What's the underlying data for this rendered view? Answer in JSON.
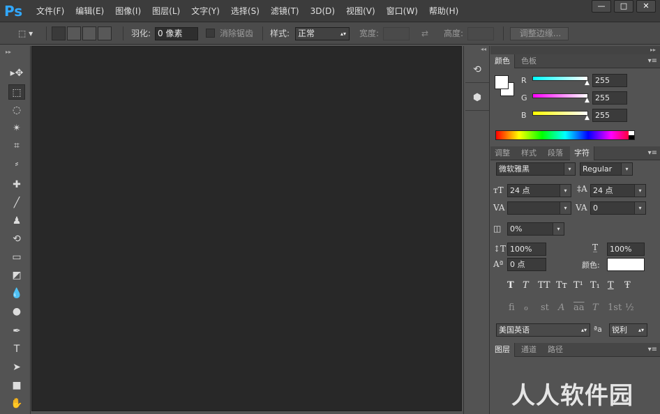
{
  "app": {
    "logo": "Ps"
  },
  "menu": [
    "文件(F)",
    "编辑(E)",
    "图像(I)",
    "图层(L)",
    "文字(Y)",
    "选择(S)",
    "滤镜(T)",
    "3D(D)",
    "视图(V)",
    "窗口(W)",
    "帮助(H)"
  ],
  "window_controls": {
    "minimize": "—",
    "maximize": "□",
    "close": "✕"
  },
  "options": {
    "feather_label": "羽化:",
    "feather_value": "0 像素",
    "antialias_label": "消除锯齿",
    "style_label": "样式:",
    "style_value": "正常",
    "width_label": "宽度:",
    "height_label": "高度:",
    "refine_edge": "调整边缘..."
  },
  "tools": [
    "move-tool",
    "marquee-tool",
    "lasso-tool",
    "magic-wand-tool",
    "crop-tool",
    "eyedropper-tool",
    "healing-tool",
    "brush-tool",
    "stamp-tool",
    "history-brush-tool",
    "eraser-tool",
    "paint-bucket-tool",
    "blur-tool",
    "dodge-tool",
    "pen-tool",
    "type-tool",
    "path-select-tool",
    "rectangle-tool",
    "hand-tool"
  ],
  "tool_glyphs": [
    "▸✥",
    "⬚",
    "◌",
    "✴",
    "⌗",
    "⸗",
    "✚",
    "╱",
    "♟",
    "⟲",
    "▭",
    "◩",
    "💧",
    "●",
    "✒",
    "T",
    "➤",
    "■",
    "✋"
  ],
  "color_panel": {
    "tabs": [
      "颜色",
      "色板"
    ],
    "channels": [
      {
        "label": "R",
        "value": "255",
        "gradient": "#00ffff"
      },
      {
        "label": "G",
        "value": "255",
        "gradient": "#ff00ff"
      },
      {
        "label": "B",
        "value": "255",
        "gradient": "#ffff00"
      }
    ]
  },
  "char_panel": {
    "tabs": [
      "调整",
      "样式",
      "段落",
      "字符"
    ],
    "font_family": "微软雅黑",
    "font_style": "Regular",
    "font_size": "24 点",
    "leading": "24 点",
    "kerning": "",
    "tracking": "0",
    "scale_tsume": "0%",
    "vertical_scale": "100%",
    "horizontal_scale": "100%",
    "baseline_shift": "0 点",
    "color_label": "颜色:",
    "color_value": "#ffffff",
    "typo_buttons": [
      "T",
      "T",
      "TT",
      "Tт",
      "T¹",
      "T₁",
      "T",
      "Ŧ"
    ],
    "ot_buttons": [
      "fi",
      "ℴ",
      "st",
      "A",
      "aa",
      "T",
      "1st",
      "½"
    ],
    "language": "美国英语",
    "aa_icon": "ªa",
    "antialias": "锐利"
  },
  "layers_panel": {
    "tabs": [
      "图层",
      "通道",
      "路径"
    ]
  },
  "watermark": "人人软件园"
}
